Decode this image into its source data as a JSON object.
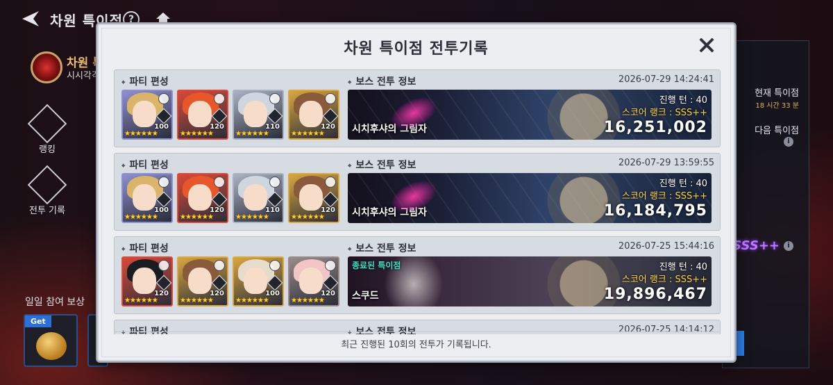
{
  "topbar": {
    "title": "차원 특이점"
  },
  "sidebar": {
    "name": "차원 특",
    "sub": "시시각각",
    "ranking_label": "랭킹",
    "battle_log_label": "전투 기록",
    "daily_reward_label": "일일 참여 보상",
    "reward_tag": "Get"
  },
  "right_panel": {
    "current_label": "현재 특이점",
    "time_left": "18 시간 33 분",
    "next_label": "다음 특이점",
    "rank_text": "SSS++"
  },
  "modal": {
    "title": "차원 특이점 전투기록",
    "footer": "최근 진행된 10회의 전투가 기록됩니다.",
    "party_label": "파티 편성",
    "boss_label": "보스 전투 정보"
  },
  "records": [
    {
      "date": "2026-07-29 14:24:41",
      "heroes": [
        {
          "level": "100",
          "stars": "★★★★★★",
          "hair": "#d9b46a",
          "border": "#8f8fd0"
        },
        {
          "level": "120",
          "stars": "★★★★★★",
          "hair": "#e8562c",
          "border": "#d94a3a"
        },
        {
          "level": "110",
          "stars": "★★★★★★",
          "hair": "#cfd6e0",
          "border": "#aab2c2"
        },
        {
          "level": "120",
          "stars": "★★★★★★",
          "hair": "#8a5a3a",
          "border": "#d9a640"
        }
      ],
      "boss_name": "시치후샤의 그림자",
      "boss_ended": "",
      "turn": "진행 턴 : 40",
      "rank": "스코어 랭크 : SSS++",
      "score": "16,251,002"
    },
    {
      "date": "2026-07-29 13:59:55",
      "heroes": [
        {
          "level": "100",
          "stars": "★★★★★★",
          "hair": "#d9b46a",
          "border": "#8f8fd0"
        },
        {
          "level": "120",
          "stars": "★★★★★★",
          "hair": "#e8562c",
          "border": "#d94a3a"
        },
        {
          "level": "110",
          "stars": "★★★★★★",
          "hair": "#cfd6e0",
          "border": "#aab2c2"
        },
        {
          "level": "120",
          "stars": "★★★★★★",
          "hair": "#8a5a3a",
          "border": "#d9a640"
        }
      ],
      "boss_name": "시치후샤의 그림자",
      "boss_ended": "",
      "turn": "진행 턴 : 40",
      "rank": "스코어 랭크 : SSS++",
      "score": "16,184,795"
    },
    {
      "date": "2026-07-25 15:44:16",
      "heroes": [
        {
          "level": "120",
          "stars": "★★★★★★",
          "hair": "#1b1b22",
          "border": "#d94a3a"
        },
        {
          "level": "120",
          "stars": "★★★★★★",
          "hair": "#8a5a3a",
          "border": "#d9a640"
        },
        {
          "level": "100",
          "stars": "★★★★★★",
          "hair": "#e6dccb",
          "border": "#d9a640"
        },
        {
          "level": "120",
          "stars": "★★★★★★",
          "hair": "#f2c6c6",
          "border": "#9a8a8a"
        }
      ],
      "boss_name": "스쿠드",
      "boss_ended": "종료된 특이점",
      "turn": "진행 턴 : 40",
      "rank": "스코어 랭크 : SSS++",
      "score": "19,896,467"
    },
    {
      "date": "2026-07-25 14:14:12"
    }
  ]
}
